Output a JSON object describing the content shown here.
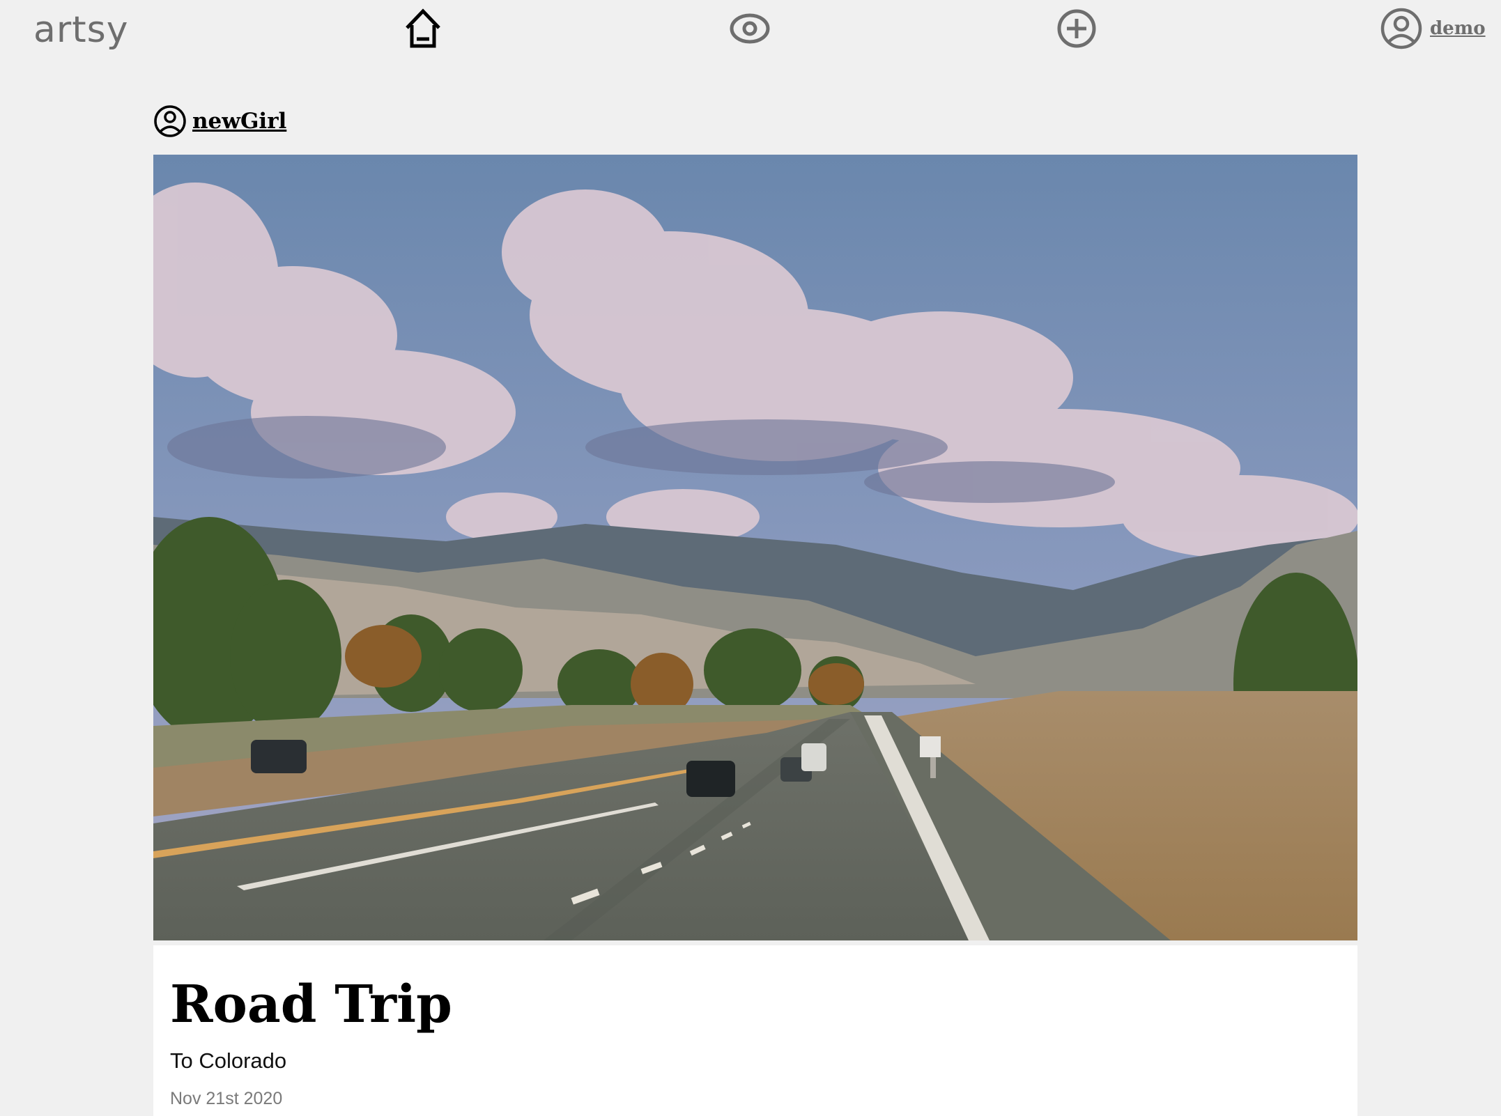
{
  "nav": {
    "logo": "artsy",
    "icons": [
      "home-icon",
      "eye-icon",
      "plus-circle-icon",
      "user-circle-icon"
    ],
    "username": "demo"
  },
  "post": {
    "author": "newGirl",
    "title": "Road Trip",
    "subtitle": "To Colorado",
    "date": "Nov 21st 2020"
  },
  "colors": {
    "background": "#f0f0f0",
    "card": "#ffffff",
    "icon_active": "#000000",
    "icon_inactive": "#6e6e6e",
    "date_text": "#7a7a7a"
  }
}
